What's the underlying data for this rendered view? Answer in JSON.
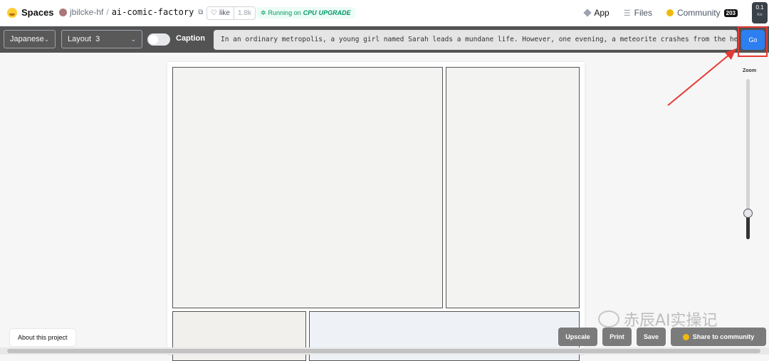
{
  "header": {
    "brand": "Spaces",
    "owner": "jbilcke-hf",
    "separator": "/",
    "space_name": "ai-comic-factory",
    "like_label": "like",
    "like_count": "1.8k",
    "status_running": "Running on",
    "status_hw": "CPU",
    "status_upgrade": "UPGRADE",
    "nav": {
      "app": "App",
      "files": "Files",
      "community": "Community",
      "community_count": "203"
    },
    "speed_value": "0.1",
    "speed_unit": "K/s"
  },
  "toolbar": {
    "style_select": "Japanese",
    "layout_select": "Layout  3",
    "caption_label": "Caption",
    "caption_enabled": false,
    "prompt_value": "In an ordinary metropolis, a young girl named Sarah leads a mundane life. However, one evening, a meteorite crashes from the heavens,",
    "go_label": "Go"
  },
  "zoom": {
    "label": "Zoom",
    "value_fraction": 0.16
  },
  "footer": {
    "about": "About this project",
    "upscale": "Upscale",
    "print": "Print",
    "save": "Save",
    "share": "Share to community"
  },
  "watermark": "赤辰AI实操记",
  "colors": {
    "go_button": "#2d7ef0",
    "highlight": "#e53935",
    "toolbar_bg": "#535353"
  }
}
